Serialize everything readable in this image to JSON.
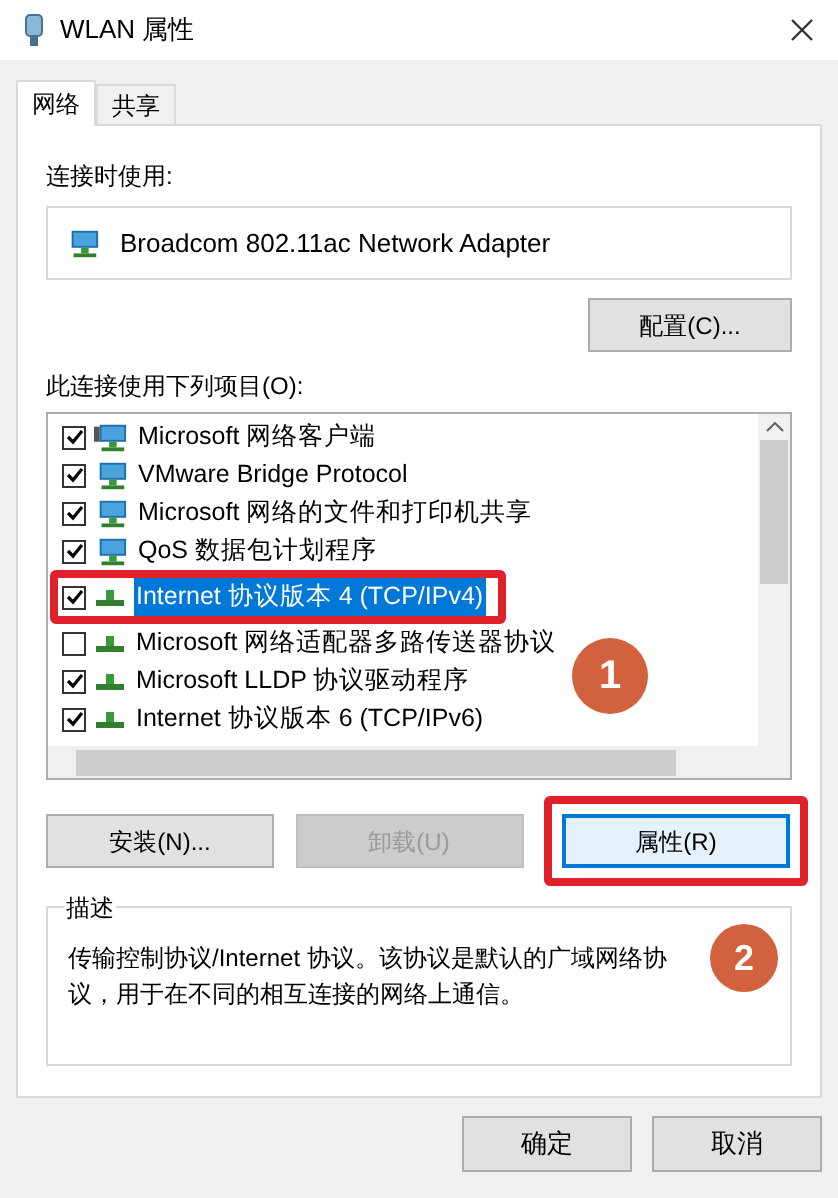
{
  "window": {
    "title": "WLAN 属性"
  },
  "tabs": [
    {
      "label": "网络",
      "selected": true
    },
    {
      "label": "共享",
      "selected": false
    }
  ],
  "connect_using": {
    "label": "连接时使用:",
    "adapter": "Broadcom 802.11ac Network Adapter"
  },
  "configure_button": "配置(C)...",
  "items_label": "此连接使用下列项目(O):",
  "items": [
    {
      "label": "Microsoft 网络客户端",
      "checked": true,
      "selected": false,
      "highlighted": false,
      "kind": "client"
    },
    {
      "label": "VMware Bridge Protocol",
      "checked": true,
      "selected": false,
      "highlighted": false,
      "kind": "service"
    },
    {
      "label": "Microsoft 网络的文件和打印机共享",
      "checked": true,
      "selected": false,
      "highlighted": false,
      "kind": "service"
    },
    {
      "label": "QoS 数据包计划程序",
      "checked": true,
      "selected": false,
      "highlighted": false,
      "kind": "service"
    },
    {
      "label": "Internet 协议版本 4 (TCP/IPv4)",
      "checked": true,
      "selected": true,
      "highlighted": true,
      "kind": "protocol"
    },
    {
      "label": "Microsoft 网络适配器多路传送器协议",
      "checked": false,
      "selected": false,
      "highlighted": false,
      "kind": "protocol"
    },
    {
      "label": "Microsoft LLDP 协议驱动程序",
      "checked": true,
      "selected": false,
      "highlighted": false,
      "kind": "protocol"
    },
    {
      "label": "Internet 协议版本 6 (TCP/IPv6)",
      "checked": true,
      "selected": false,
      "highlighted": false,
      "kind": "protocol"
    }
  ],
  "buttons": [
    {
      "label": "安装(N)...",
      "disabled": false,
      "focused": false,
      "highlighted": false
    },
    {
      "label": "卸载(U)",
      "disabled": true,
      "focused": false,
      "highlighted": false
    },
    {
      "label": "属性(R)",
      "disabled": false,
      "focused": true,
      "highlighted": true
    }
  ],
  "description": {
    "legend": "描述",
    "text": "传输控制协议/Internet 协议。该协议是默认的广域网络协议，用于在不同的相互连接的网络上通信。"
  },
  "dialog_buttons": [
    "确定",
    "取消"
  ],
  "callouts": [
    "1",
    "2"
  ]
}
